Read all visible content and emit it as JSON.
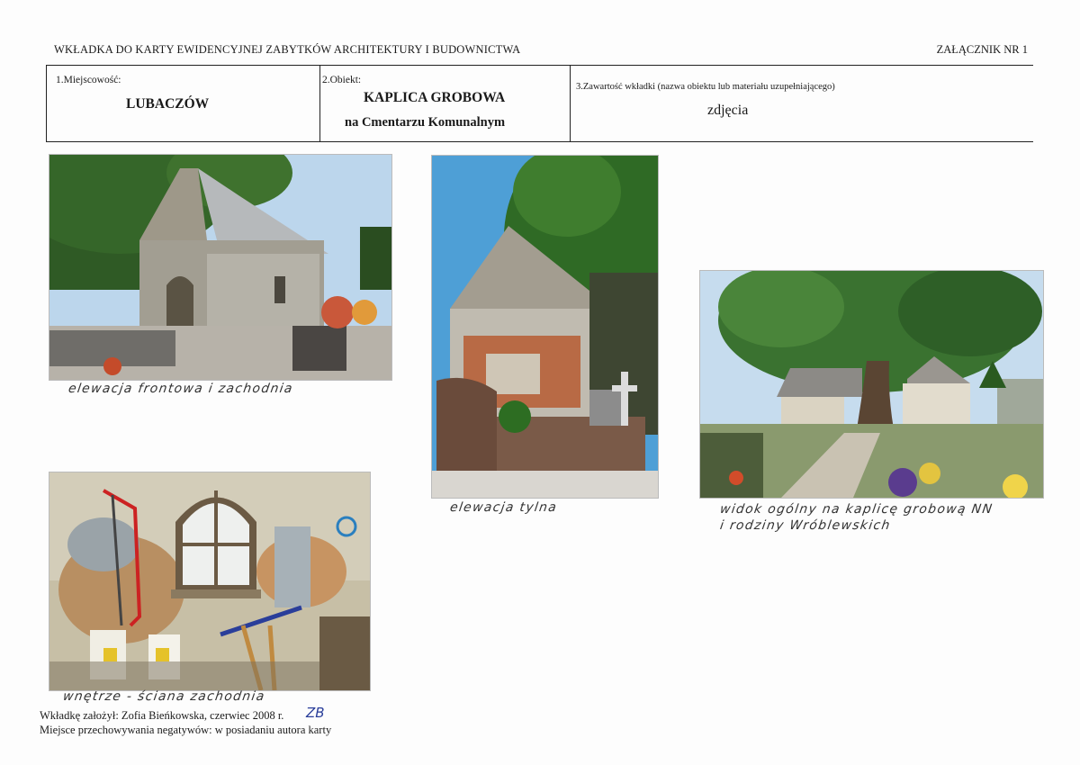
{
  "header": {
    "title": "WKŁADKA DO KARTY EWIDENCYJNEJ ZABYTKÓW ARCHITEKTURY I BUDOWNICTWA",
    "attachment": "ZAŁĄCZNIK NR 1"
  },
  "form": {
    "field1_label": "1.Miejscowość:",
    "field1_value": "LUBACZÓW",
    "field2_label": "2.Obiekt:",
    "field2_value_line1": "KAPLICA GROBOWA",
    "field2_value_line2": "na Cmentarzu Komunalnym",
    "field3_label": "3.Zawartość wkładki (nazwa obiektu lub materiału uzupełniającego)",
    "field3_value": "zdjęcia"
  },
  "photos": [
    {
      "caption": "elewacja frontowa i zachodnia"
    },
    {
      "caption": "elewacja tylna"
    },
    {
      "caption_line1": "widok ogólny na kaplicę grobową NN",
      "caption_line2": "i rodziny Wróblewskich"
    },
    {
      "caption": "wnętrze - ściana zachodnia"
    }
  ],
  "footer": {
    "line1": "Wkładkę założył: Zofia Bieńkowska, czerwiec 2008 r.",
    "signature": "ZB",
    "line2": "Miejsce przechowywania negatywów: w posiadaniu autora karty"
  }
}
